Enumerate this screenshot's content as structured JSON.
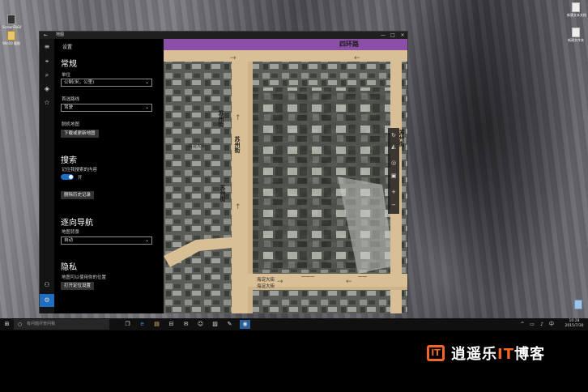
{
  "window": {
    "title": "地图",
    "back_glyph": "←",
    "minimize": "—",
    "maximize": "□",
    "close": "×"
  },
  "settings": {
    "header": "设置",
    "general": {
      "title": "常规",
      "units_label": "单位",
      "units_value": "公制(米，公里)",
      "route_label": "首选路线",
      "route_value": "驾驶",
      "offline_label": "脱机地图",
      "offline_button": "下载或更新地图"
    },
    "search": {
      "title": "搜索",
      "remember_label": "记住我搜索的内容",
      "toggle_state": "开",
      "clear_button": "删除历史记录"
    },
    "navigation": {
      "title": "逐向导航",
      "background_label": "地图背景",
      "background_value": "自动"
    },
    "privacy": {
      "title": "隐私",
      "location_label": "地图可以使用你的位置",
      "location_button": "打开定位设置"
    }
  },
  "map": {
    "labels": {
      "north_road": "四环路",
      "east_label": "苏州街",
      "haidian_street_1": "海淀大街",
      "haidian_street_2": "海淀大街",
      "west_label_1": "海淀大街",
      "su_street": "苏州街",
      "street_a": "苏州街",
      "street_b": "苏州街",
      "small_1": "一一一",
      "small_2": "一一"
    }
  },
  "taskbar": {
    "search_placeholder": "有问题尽管问我",
    "clock_time": "10:28",
    "clock_date": "2015/7/30"
  },
  "desktop": {
    "icon_labels": [
      "新建文本文档",
      "新建文件夹"
    ],
    "left_icon_labels": [
      "ScreenToGif",
      "Win10 截图"
    ]
  },
  "brand": {
    "mark": "IT",
    "prefix": "逍遥乐",
    "highlight": "IT",
    "suffix": "博客"
  },
  "colors": {
    "accent": "#1e6fc4",
    "brand_orange": "#f26522",
    "road": "#d9bf96",
    "purple_road": "#8b4fa8"
  }
}
